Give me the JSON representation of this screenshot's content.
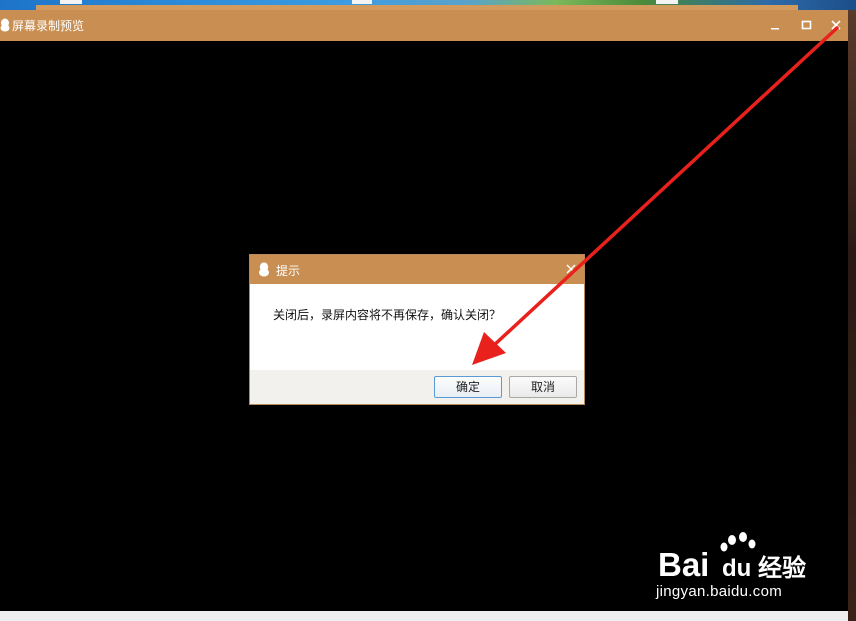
{
  "window": {
    "title": "屏幕录制预览",
    "minimize_icon": "minimize-icon",
    "maximize_icon": "maximize-icon",
    "close_icon": "close-icon"
  },
  "dialog": {
    "title": "提示",
    "message": "关闭后，录屏内容将不再保存，确认关闭？",
    "ok_label": "确定",
    "cancel_label": "取消"
  },
  "watermark": {
    "logo_text": "Bai",
    "logo_text2": "du",
    "logo_cn": "经验",
    "url": "jingyan.baidu.com"
  },
  "colors": {
    "titlebar": "#c98f52",
    "annotation_arrow": "#e8211d",
    "ok_border": "#5b9bd5"
  }
}
